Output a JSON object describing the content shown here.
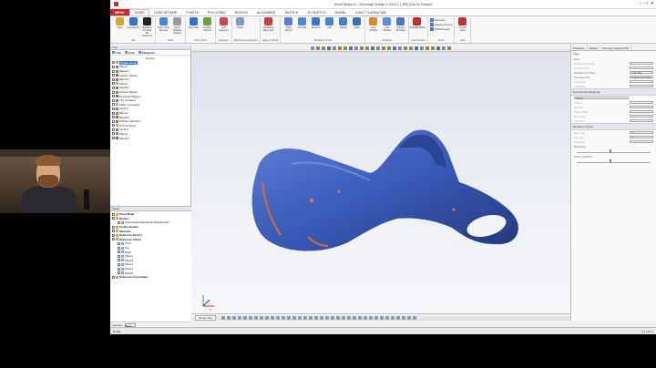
{
  "window": {
    "title": "Sheet Metal.xrl - Geomagic Design X 2016.2.1 [R4] [Not for Resale]",
    "min_glyph": "–",
    "max_glyph": "□",
    "close_glyph": "✕"
  },
  "ribbon_tabs": {
    "menu": "MENU",
    "tabs": [
      "HOME",
      "LIVECAPTURE",
      "POINTS",
      "POLYGONS",
      "REGION",
      "ALIGNMENT",
      "SKETCH",
      "3D SKETCH",
      "MODEL",
      "EXACT SURFACING"
    ]
  },
  "ribbon_groups": [
    {
      "name": "File",
      "buttons": [
        {
          "label": "Open",
          "color": "#d9a92b"
        },
        {
          "label": "LiveCapture",
          "color": "#3a6fc9"
        },
        {
          "label": "Creaform Portable 3D Scanners",
          "color": "#222222"
        }
      ]
    },
    {
      "name": "Scan",
      "buttons": [
        {
          "label": "Scan Tools Process",
          "color": "#3a8ad6"
        },
        {
          "label": "Mesh Buildup Wizard",
          "color": "#9b9b9b"
        }
      ]
    },
    {
      "name": "Scan Tools",
      "buttons": [
        {
          "label": "Decimate",
          "color": "#3a6fc9"
        },
        {
          "label": "Healing Wizard",
          "color": "#6a9c3c"
        }
      ]
    },
    {
      "name": "Regions",
      "buttons": [
        {
          "label": "Auto Segment",
          "color": "#c84a4a"
        }
      ]
    },
    {
      "name": "Reference Geometry",
      "buttons": [
        {
          "label": "Plane",
          "color": "#7a9ad0"
        }
      ]
    },
    {
      "name": "Align to World",
      "buttons": [
        {
          "label": "Interactive Alignment",
          "color": "#c83e3e"
        }
      ]
    },
    {
      "name": "Modeling Tools",
      "buttons": [
        {
          "label": "Mesh Sketch",
          "color": "#5a7ec9"
        },
        {
          "label": "Extrude",
          "color": "#4d86d6"
        },
        {
          "label": "Revolve",
          "color": "#3f73c4"
        },
        {
          "label": "Loft",
          "color": "#4a82c6"
        },
        {
          "label": "Sweep",
          "color": "#4a7fc0"
        },
        {
          "label": "Fillet",
          "color": "#3d6eb8"
        }
      ]
    },
    {
      "name": "Surfaces",
      "buttons": [
        {
          "label": "Auto Surface",
          "color": "#d88a2d"
        },
        {
          "label": "Loft Wizard",
          "color": "#5d8ed4"
        },
        {
          "label": "Surface Primitive",
          "color": "#4b78c2"
        }
      ]
    },
    {
      "name": "LiveTransfer",
      "buttons": [
        {
          "label": "SOLIDWORKS",
          "color": "#cc2a2a"
        }
      ]
    }
  ],
  "ribbon_tools": {
    "name": "Tools",
    "items": [
      "View Clip",
      "Capture Screen",
      "Walk-through"
    ]
  },
  "ribbon_help": {
    "name": "Help",
    "label": "Context Help",
    "color": "#c83030"
  },
  "left_pane": {
    "header": "Tree",
    "tools": [
      "Tree",
      "Help",
      "Viewpoint"
    ],
    "feature_label": "Feature",
    "features": [
      {
        "label": "Region Group",
        "selected": true
      },
      {
        "label": "Plane1"
      },
      {
        "label": "Sketch1"
      },
      {
        "label": "Surface Plane1"
      },
      {
        "label": "Sketch1"
      },
      {
        "label": "Plane2"
      },
      {
        "label": "Sketch1"
      },
      {
        "label": "Surface Plane2"
      },
      {
        "label": "Decimate Polygon"
      },
      {
        "label": "Thin Surface1"
      },
      {
        "label": "Fillet1 (Constant)"
      },
      {
        "label": "Vector1"
      },
      {
        "label": "Plane3"
      },
      {
        "label": "Sketch2"
      },
      {
        "label": "Surface Cylinder1"
      },
      {
        "label": "Trim Surface1"
      },
      {
        "label": "Vector2"
      },
      {
        "label": "Plane4"
      },
      {
        "label": "Sketch4"
      }
    ],
    "model_label": "Model",
    "model_items": [
      {
        "label": "Sheet Metal",
        "bold": true
      },
      {
        "label": "Meshes",
        "bold": true
      },
      {
        "label": "CapturedandCapturedandCapturedan"
      },
      {
        "label": "Surface Bodies",
        "bold": true
      },
      {
        "label": "Sketches",
        "bold": true
      },
      {
        "label": "Reference Vectors",
        "bold": true
      },
      {
        "label": "Reference Planes",
        "bold": true
      },
      {
        "label": "Front"
      },
      {
        "label": "Top"
      },
      {
        "label": "Right"
      },
      {
        "label": "Plane1"
      },
      {
        "label": "Plane2"
      },
      {
        "label": "Plane3"
      },
      {
        "label": "Plane4"
      },
      {
        "label": "Plane5"
      },
      {
        "label": "Reference Coordinates",
        "bold": true
      }
    ],
    "filter_label": "Selection",
    "filter_value": "Body"
  },
  "viewport": {
    "tab_label": "Model View",
    "axis_label": "X"
  },
  "right_pane": {
    "tabs": [
      "Properties",
      "Display",
      "Accuracy Analyzer(TM)"
    ],
    "type_section": "Type",
    "type_value": "None",
    "rows": [
      {
        "label": "Deviation for Body",
        "value": "",
        "muted": true
      },
      {
        "label": "Compare with",
        "value": "",
        "muted": true
      },
      {
        "label": "Deviation for Mesh",
        "value": "Color Map",
        "muted": false
      },
      {
        "label": "Compare with",
        "value": "Original Scan Data",
        "muted": false
      },
      {
        "label": "Curvature",
        "value": "",
        "muted": true
      },
      {
        "label": "Continuity",
        "value": "",
        "muted": true
      }
    ],
    "env_header": "Environment Mapping",
    "env_value": "Stripes",
    "env_rows": [
      "Stripes",
      "Direction",
      "Stripe Width",
      "Resolution",
      "Color Bar"
    ],
    "deviation_header": "Deviation Option",
    "deviation_rows": [
      {
        "label": "Max. Dev",
        "value": "50"
      },
      {
        "label": "Min. Dev",
        "value": "50"
      },
      {
        "label": "Tolerance",
        "value": ""
      }
    ],
    "resolution_label": "Resolution",
    "vector_label": "Vector Multiplier"
  },
  "statusbar": {
    "left": "Ready",
    "right": "0 / 1.21 s"
  }
}
